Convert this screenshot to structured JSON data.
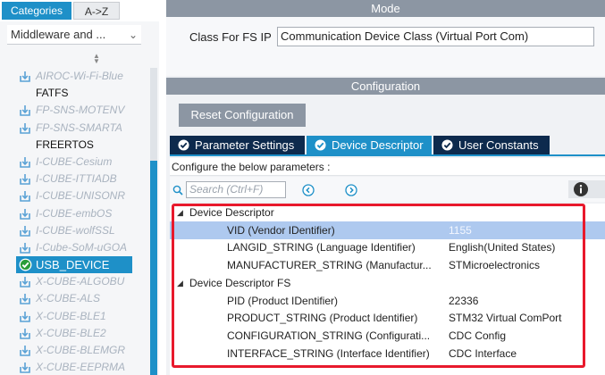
{
  "sidebar": {
    "tabs": [
      {
        "label": "Categories",
        "active": true
      },
      {
        "label": "A->Z",
        "active": false
      }
    ],
    "category_select": {
      "value": "Middleware and ...",
      "icon": "chevron-down-icon"
    },
    "sort_icon": "sort-arrows-icon",
    "items": [
      {
        "label": "AIROC-Wi-Fi-Blue",
        "state": "disabled",
        "icon": "download-icon"
      },
      {
        "label": "FATFS",
        "state": "enabled",
        "icon": ""
      },
      {
        "label": "FP-SNS-MOTENV",
        "state": "disabled",
        "icon": "download-icon"
      },
      {
        "label": "FP-SNS-SMARTA",
        "state": "disabled",
        "icon": "download-icon"
      },
      {
        "label": "FREERTOS",
        "state": "enabled",
        "icon": ""
      },
      {
        "label": "I-CUBE-Cesium",
        "state": "disabled",
        "icon": "download-icon"
      },
      {
        "label": "I-CUBE-ITTIADB",
        "state": "disabled",
        "icon": "download-icon"
      },
      {
        "label": "I-CUBE-UNISONR",
        "state": "disabled",
        "icon": "download-icon"
      },
      {
        "label": "I-CUBE-embOS",
        "state": "disabled",
        "icon": "download-icon"
      },
      {
        "label": "I-CUBE-wolfSSL",
        "state": "disabled",
        "icon": "download-icon"
      },
      {
        "label": "I-Cube-SoM-uGOA",
        "state": "disabled",
        "icon": "download-icon"
      },
      {
        "label": "USB_DEVICE",
        "state": "selected",
        "icon": "check-circle-icon"
      },
      {
        "label": "X-CUBE-ALGOBU",
        "state": "disabled",
        "icon": "download-icon"
      },
      {
        "label": "X-CUBE-ALS",
        "state": "disabled",
        "icon": "download-icon"
      },
      {
        "label": "X-CUBE-BLE1",
        "state": "disabled",
        "icon": "download-icon"
      },
      {
        "label": "X-CUBE-BLE2",
        "state": "disabled",
        "icon": "download-icon"
      },
      {
        "label": "X-CUBE-BLEMGR",
        "state": "disabled",
        "icon": "download-icon"
      },
      {
        "label": "X-CUBE-EEPRMA",
        "state": "disabled",
        "icon": "download-icon"
      }
    ]
  },
  "mode": {
    "header": "Mode",
    "class_label": "Class For FS IP",
    "class_value": "Communication Device Class (Virtual Port Com)"
  },
  "configuration": {
    "header": "Configuration",
    "reset_label": "Reset Configuration",
    "tabs": [
      {
        "label": "Parameter Settings",
        "active": false
      },
      {
        "label": "Device Descriptor",
        "active": true
      },
      {
        "label": "User Constants",
        "active": false
      }
    ],
    "note": "Configure the below parameters :",
    "search_placeholder": "Search (Ctrl+F)",
    "icons": [
      "search-icon",
      "prev-icon",
      "next-icon",
      "info-icon"
    ],
    "groups": [
      {
        "name": "Device Descriptor",
        "params": [
          {
            "key": "VID (Vendor IDentifier)",
            "value": "1155",
            "selected": true
          },
          {
            "key": "LANGID_STRING (Language Identifier)",
            "value": "English(United States)"
          },
          {
            "key": "MANUFACTURER_STRING (Manufactur...",
            "value": "STMicroelectronics"
          }
        ]
      },
      {
        "name": "Device Descriptor FS",
        "params": [
          {
            "key": "PID (Product IDentifier)",
            "value": "22336"
          },
          {
            "key": "PRODUCT_STRING (Product Identifier)",
            "value": "STM32 Virtual ComPort"
          },
          {
            "key": "CONFIGURATION_STRING (Configurati...",
            "value": "CDC Config"
          },
          {
            "key": "INTERFACE_STRING (Interface Identifier)",
            "value": "CDC Interface"
          }
        ]
      }
    ]
  },
  "colors": {
    "accent": "#1e90c8",
    "dark_tab": "#0d2a4d",
    "header_gray": "#8c96a3",
    "row_highlight": "#aec9ef",
    "annotation_red": "#e8192c"
  }
}
